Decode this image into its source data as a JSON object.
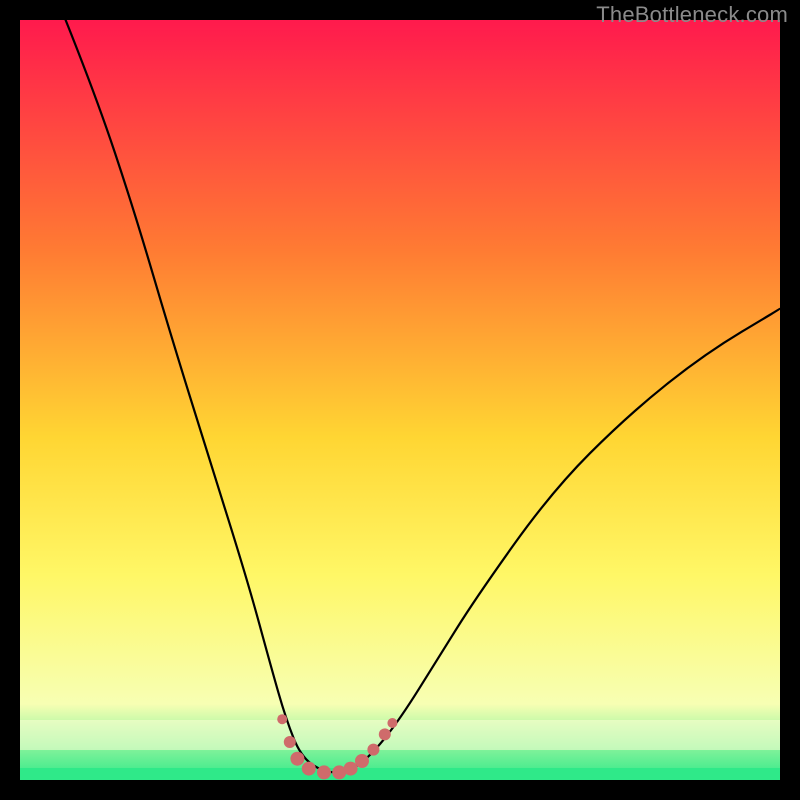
{
  "watermark": "TheBottleneck.com",
  "chart_data": {
    "type": "line",
    "title": "",
    "xlabel": "",
    "ylabel": "",
    "xlim": [
      0,
      100
    ],
    "ylim": [
      0,
      100
    ],
    "curve_description": "V-shaped bottleneck curve: steep descent from top-left to a flat minimum near x≈40, then gentler rise toward the right edge",
    "curve_points": [
      {
        "x": 6,
        "y": 100
      },
      {
        "x": 10,
        "y": 90
      },
      {
        "x": 15,
        "y": 75
      },
      {
        "x": 20,
        "y": 58
      },
      {
        "x": 25,
        "y": 42
      },
      {
        "x": 30,
        "y": 26
      },
      {
        "x": 33,
        "y": 15
      },
      {
        "x": 35,
        "y": 8
      },
      {
        "x": 37,
        "y": 3
      },
      {
        "x": 40,
        "y": 1
      },
      {
        "x": 43,
        "y": 1
      },
      {
        "x": 46,
        "y": 3
      },
      {
        "x": 50,
        "y": 8
      },
      {
        "x": 55,
        "y": 16
      },
      {
        "x": 60,
        "y": 24
      },
      {
        "x": 70,
        "y": 38
      },
      {
        "x": 80,
        "y": 48
      },
      {
        "x": 90,
        "y": 56
      },
      {
        "x": 100,
        "y": 62
      }
    ],
    "markers": {
      "color": "#cf6b6b",
      "points": [
        {
          "x": 34.5,
          "y": 8.0,
          "r": 5
        },
        {
          "x": 35.5,
          "y": 5.0,
          "r": 6
        },
        {
          "x": 36.5,
          "y": 2.8,
          "r": 7
        },
        {
          "x": 38.0,
          "y": 1.5,
          "r": 7
        },
        {
          "x": 40.0,
          "y": 1.0,
          "r": 7
        },
        {
          "x": 42.0,
          "y": 1.0,
          "r": 7
        },
        {
          "x": 43.5,
          "y": 1.5,
          "r": 7
        },
        {
          "x": 45.0,
          "y": 2.5,
          "r": 7
        },
        {
          "x": 46.5,
          "y": 4.0,
          "r": 6
        },
        {
          "x": 48.0,
          "y": 6.0,
          "r": 6
        },
        {
          "x": 49.0,
          "y": 7.5,
          "r": 5
        }
      ]
    },
    "background_gradient": {
      "top": "#ff1a4d",
      "mid_upper": "#ff7a33",
      "mid": "#ffd633",
      "mid_lower": "#fff766",
      "band": "#f7ffb3",
      "bottom": "#2fe989"
    }
  }
}
